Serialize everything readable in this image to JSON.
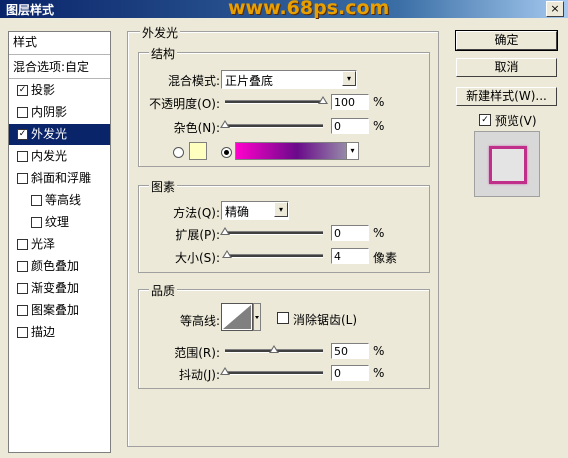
{
  "window": {
    "title": "图层样式",
    "watermark": "www.68ps.com",
    "close_label": "×"
  },
  "sidebar": {
    "header": "样式",
    "blend_options": "混合选项:自定",
    "items": [
      {
        "label": "投影",
        "checked": true
      },
      {
        "label": "内阴影",
        "checked": false
      },
      {
        "label": "外发光",
        "checked": true,
        "selected": true
      },
      {
        "label": "内发光",
        "checked": false
      },
      {
        "label": "斜面和浮雕",
        "checked": false
      },
      {
        "label": "等高线",
        "checked": false,
        "sub": true
      },
      {
        "label": "纹理",
        "checked": false,
        "sub": true
      },
      {
        "label": "光泽",
        "checked": false
      },
      {
        "label": "颜色叠加",
        "checked": false
      },
      {
        "label": "渐变叠加",
        "checked": false
      },
      {
        "label": "图案叠加",
        "checked": false
      },
      {
        "label": "描边",
        "checked": false
      }
    ]
  },
  "outer_glow": {
    "title": "外发光",
    "structure": {
      "title": "结构",
      "blend_mode_label": "混合模式:",
      "blend_mode_value": "正片叠底",
      "opacity_label": "不透明度(O):",
      "opacity_value": "100",
      "opacity_unit": "%",
      "opacity_fraction": 1.0,
      "noise_label": "杂色(N):",
      "noise_value": "0",
      "noise_unit": "%",
      "noise_fraction": 0.0,
      "solid_color": "#ffffc0",
      "gradient_colors": [
        "#ff00cc",
        "#6a0a8a",
        "#a0a8b0"
      ]
    },
    "elements": {
      "title": "图素",
      "method_label": "方法(Q):",
      "method_value": "精确",
      "spread_label": "扩展(P):",
      "spread_value": "0",
      "spread_unit": "%",
      "spread_fraction": 0.0,
      "size_label": "大小(S):",
      "size_value": "4",
      "size_unit": "像素",
      "size_fraction": 0.02
    },
    "quality": {
      "title": "品质",
      "contour_label": "等高线:",
      "antialias_label": "消除锯齿(L)",
      "antialias_checked": false,
      "range_label": "范围(R):",
      "range_value": "50",
      "range_unit": "%",
      "range_fraction": 0.5,
      "jitter_label": "抖动(J):",
      "jitter_value": "0",
      "jitter_unit": "%",
      "jitter_fraction": 0.0
    }
  },
  "buttons": {
    "ok": "确定",
    "cancel": "取消",
    "new_style": "新建样式(W)...",
    "preview_label": "预览(V)",
    "preview_checked": true
  },
  "icons": {
    "dropdown": "▾",
    "check": "✓"
  }
}
